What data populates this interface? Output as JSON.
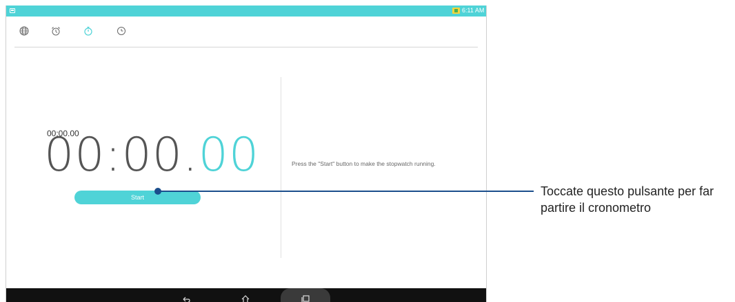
{
  "status_bar": {
    "time": "6:11 AM"
  },
  "tabs": [
    {
      "icon": "globe-icon",
      "active": false
    },
    {
      "icon": "alarm-clock-icon",
      "active": false
    },
    {
      "icon": "stopwatch-icon",
      "active": true
    },
    {
      "icon": "timer-icon",
      "active": false
    }
  ],
  "stopwatch": {
    "small_time": "00:00.00",
    "big_time_main": "00:00.",
    "big_time_hundredths": "00",
    "start_label": "Start",
    "hint": "Press the \"Start\" button to make the stopwatch running."
  },
  "callout": {
    "text_line1": "Toccate questo pulsante per far",
    "text_line2": "partire il cronometro"
  },
  "nav_bar": {
    "back_icon": "back-icon",
    "home_icon": "home-icon",
    "recents_icon": "recents-icon"
  },
  "colors": {
    "accent": "#4fd3d7",
    "callout": "#1a4d8c",
    "nav_bg": "#111111"
  }
}
